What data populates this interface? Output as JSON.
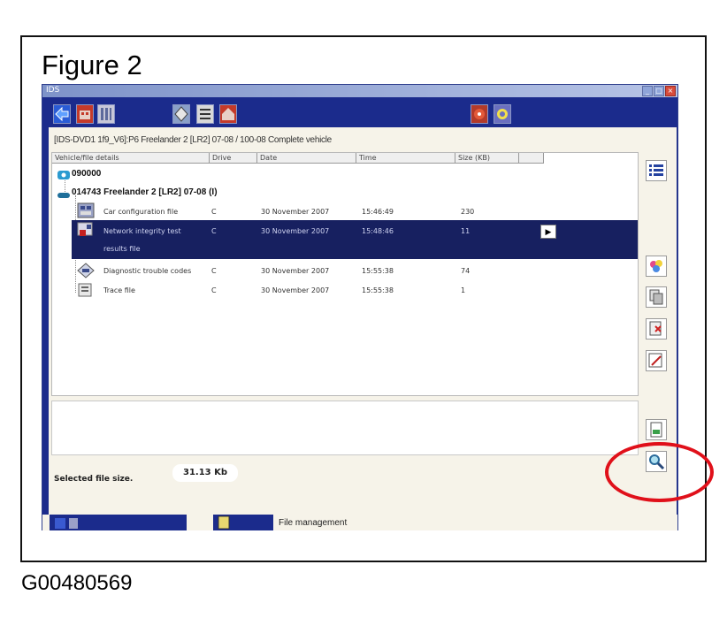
{
  "figure": {
    "title": "Figure 2",
    "code": "G00480569"
  },
  "window": {
    "title": "IDS",
    "controls": [
      "_",
      "□",
      "×"
    ]
  },
  "toolbar": {
    "icons": [
      "back-arrow-icon",
      "vehicle-icon",
      "tools-icon",
      "diagnostics-icon",
      "list-icon",
      "garage-icon",
      "connect-icon",
      "settings-icon"
    ]
  },
  "vehicle_line": "[IDS-DVD1 1f9_V6]:P6  Freelander 2 [LR2] 07-08 / 100-08 Complete vehicle",
  "columns": [
    "Vehicle/file details",
    "Drive",
    "Date",
    "Time",
    "Size (KB)"
  ],
  "tree": {
    "root": "090000",
    "vehicle": "014743 Freelander 2 [LR2] 07-08 (I)"
  },
  "rows": [
    {
      "name": "Car configuration file",
      "drive": "C",
      "date": "30 November 2007",
      "time": "15:46:49",
      "size": "230"
    },
    {
      "name": "Network integrity test",
      "name2": "results file",
      "drive": "C",
      "date": "30 November 2007",
      "time": "15:48:46",
      "size": "11"
    },
    {
      "name": "Diagnostic trouble codes",
      "drive": "C",
      "date": "30 November 2007",
      "time": "15:55:38",
      "size": "74"
    },
    {
      "name": "Trace file",
      "drive": "C",
      "date": "30 November 2007",
      "time": "15:55:38",
      "size": "1"
    }
  ],
  "selected_arrow": "▶",
  "selected_size": {
    "label": "Selected file size.",
    "value": "31.13 Kb"
  },
  "status": {
    "label": "File management"
  },
  "colors": {
    "window_blue": "#1b2b8c",
    "selection": "#172060",
    "panel": "#f6f3e9",
    "highlight": "#e0101a"
  }
}
